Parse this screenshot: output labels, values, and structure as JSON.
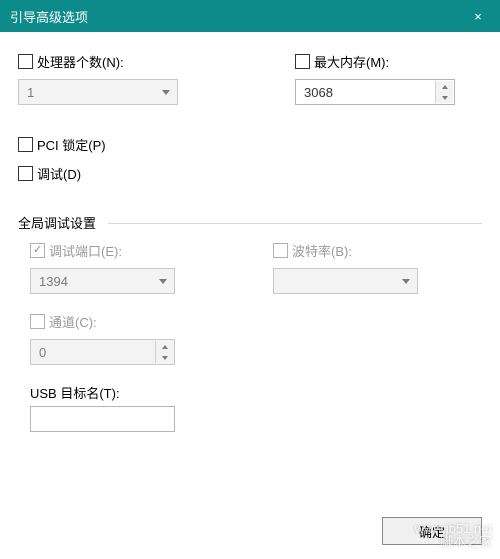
{
  "window": {
    "title": "引导高级选项",
    "close": "×"
  },
  "fields": {
    "processors": {
      "label": "处理器个数(N):",
      "value": "1"
    },
    "maxmem": {
      "label": "最大内存(M):",
      "value": "3068"
    },
    "pcilock": {
      "label": "PCI 锁定(P)"
    },
    "debug": {
      "label": "调试(D)"
    }
  },
  "group": {
    "legend": "全局调试设置",
    "debugport": {
      "label": "调试端口(E):",
      "value": "1394"
    },
    "baudrate": {
      "label": "波特率(B):",
      "value": ""
    },
    "channel": {
      "label": "通道(C):",
      "value": "0"
    },
    "usbtarget": {
      "label": "USB 目标名(T):",
      "value": ""
    }
  },
  "footer": {
    "ok": "确定"
  },
  "watermark": {
    "line1": "www.jb51.net",
    "line2": "脚本之家"
  }
}
